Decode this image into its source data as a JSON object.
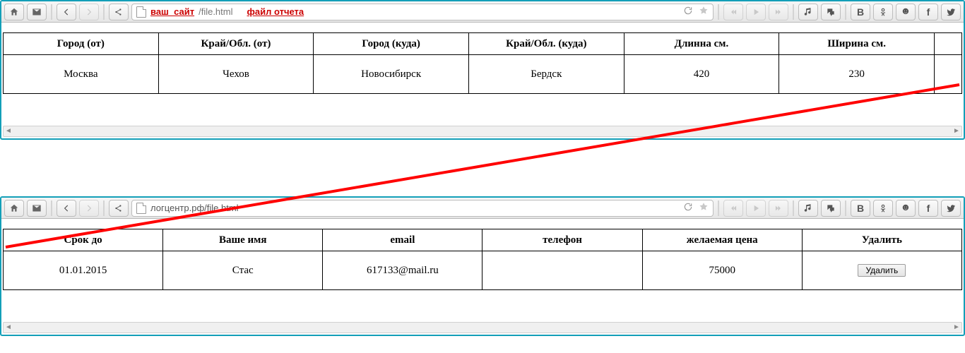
{
  "browser1": {
    "url_emph": "ваш_сайт",
    "url_path": "/file.html",
    "url_label": "файл отчета",
    "table": {
      "headers": [
        "Город (от)",
        "Край/Обл. (от)",
        "Город (куда)",
        "Край/Обл. (куда)",
        "Длинна см.",
        "Ширина см.",
        ""
      ],
      "row": [
        "Москва",
        "Чехов",
        "Новосибирск",
        "Бердск",
        "420",
        "230",
        ""
      ]
    }
  },
  "browser2": {
    "url_text": "логцентр.рф/file.html",
    "table": {
      "headers": [
        "Срок до",
        "Ваше имя",
        "email",
        "телефон",
        "желаемая цена",
        "Удалить"
      ],
      "row": [
        "01.01.2015",
        "Стас",
        "617133@mail.ru",
        "",
        "75000",
        ""
      ],
      "delete_label": "Удалить"
    }
  },
  "social": {
    "vk": "B",
    "ok": "8",
    "mo": "☻",
    "fb": "f",
    "tw": ""
  }
}
